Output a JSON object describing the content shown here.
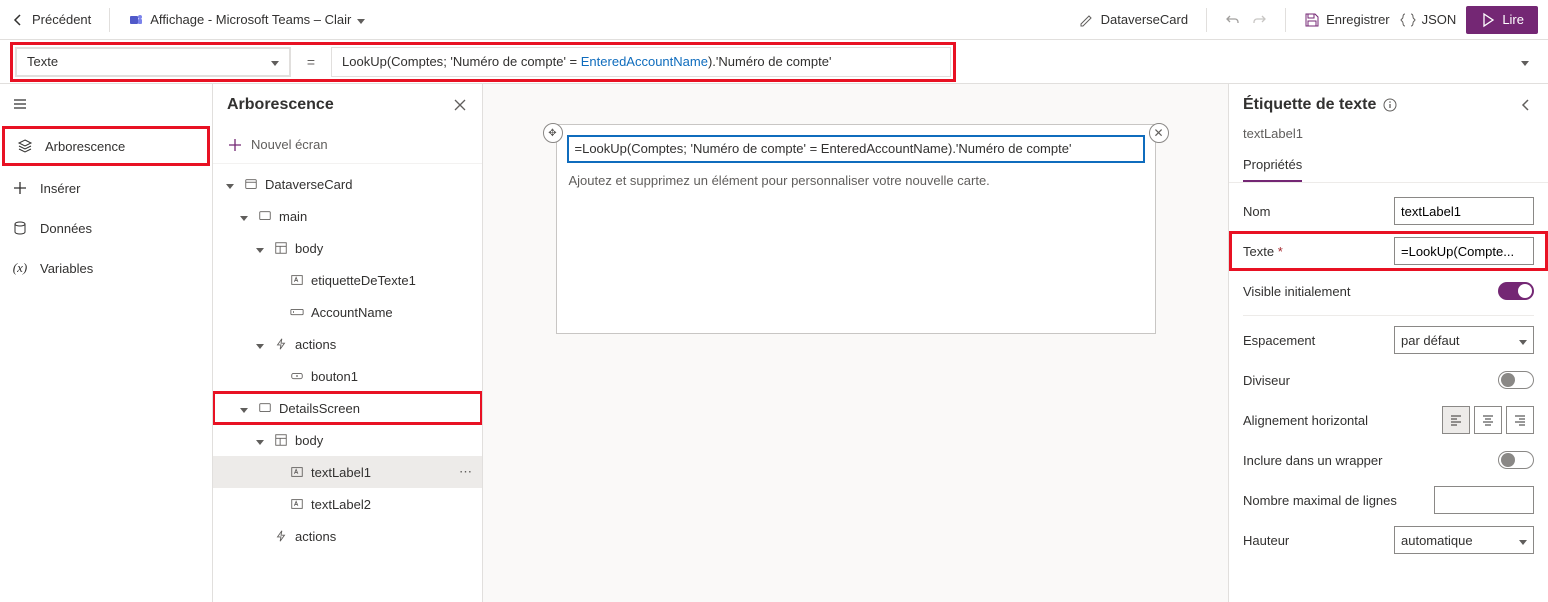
{
  "topbar": {
    "back_label": "Précédent",
    "theme_label": "Affichage - Microsoft Teams – Clair",
    "card_name": "DataverseCard",
    "save_label": "Enregistrer",
    "json_label": "JSON",
    "play_label": "Lire"
  },
  "formula_bar": {
    "property": "Texte",
    "formula_parts": {
      "p1": "LookUp",
      "p2": "(",
      "p3": "Comptes",
      "p4": "; ",
      "p5": "'Numéro de compte'",
      "p6": " = ",
      "p7": "EnteredAccountName",
      "p8": ").",
      "p9": "'Numéro de compte'"
    }
  },
  "rail": {
    "tree": "Arborescence",
    "insert": "Insérer",
    "data": "Données",
    "variables": "Variables"
  },
  "tree_panel": {
    "title": "Arborescence",
    "new_screen": "Nouvel écran",
    "nodes": [
      {
        "label": "DataverseCard",
        "indent": 0,
        "icon": "card",
        "expanded": true
      },
      {
        "label": "main",
        "indent": 1,
        "icon": "screen",
        "expanded": true
      },
      {
        "label": "body",
        "indent": 2,
        "icon": "layout",
        "expanded": true
      },
      {
        "label": "etiquetteDeTexte1",
        "indent": 3,
        "icon": "text",
        "expanded": null
      },
      {
        "label": "AccountName",
        "indent": 3,
        "icon": "input",
        "expanded": null
      },
      {
        "label": "actions",
        "indent": 2,
        "icon": "bolt",
        "expanded": true
      },
      {
        "label": "bouton1",
        "indent": 3,
        "icon": "button",
        "expanded": null
      },
      {
        "label": "DetailsScreen",
        "indent": 1,
        "icon": "screen",
        "expanded": true,
        "highlight": true
      },
      {
        "label": "body",
        "indent": 2,
        "icon": "layout",
        "expanded": true
      },
      {
        "label": "textLabel1",
        "indent": 3,
        "icon": "text",
        "expanded": null,
        "selected": true,
        "more": true
      },
      {
        "label": "textLabel2",
        "indent": 3,
        "icon": "text",
        "expanded": null
      },
      {
        "label": "actions",
        "indent": 2,
        "icon": "bolt",
        "expanded": null
      }
    ]
  },
  "canvas": {
    "field_text": "=LookUp(Comptes; 'Numéro de compte' = EnteredAccountName).'Numéro de compte'",
    "hint_text": "Ajoutez et supprimez un élément pour personnaliser votre nouvelle carte."
  },
  "props_panel": {
    "title": "Étiquette de texte",
    "subtitle": "textLabel1",
    "tab_label": "Propriétés",
    "rows": {
      "name_label": "Nom",
      "name_value": "textLabel1",
      "text_label": "Texte",
      "text_value": "=LookUp(Compte...",
      "visible_label": "Visible initialement",
      "spacing_label": "Espacement",
      "spacing_value": "par défaut",
      "divider_label": "Diviseur",
      "halign_label": "Alignement horizontal",
      "wrap_label": "Inclure dans un wrapper",
      "maxlines_label": "Nombre maximal de lignes",
      "maxlines_value": "",
      "height_label": "Hauteur",
      "height_value": "automatique"
    }
  }
}
